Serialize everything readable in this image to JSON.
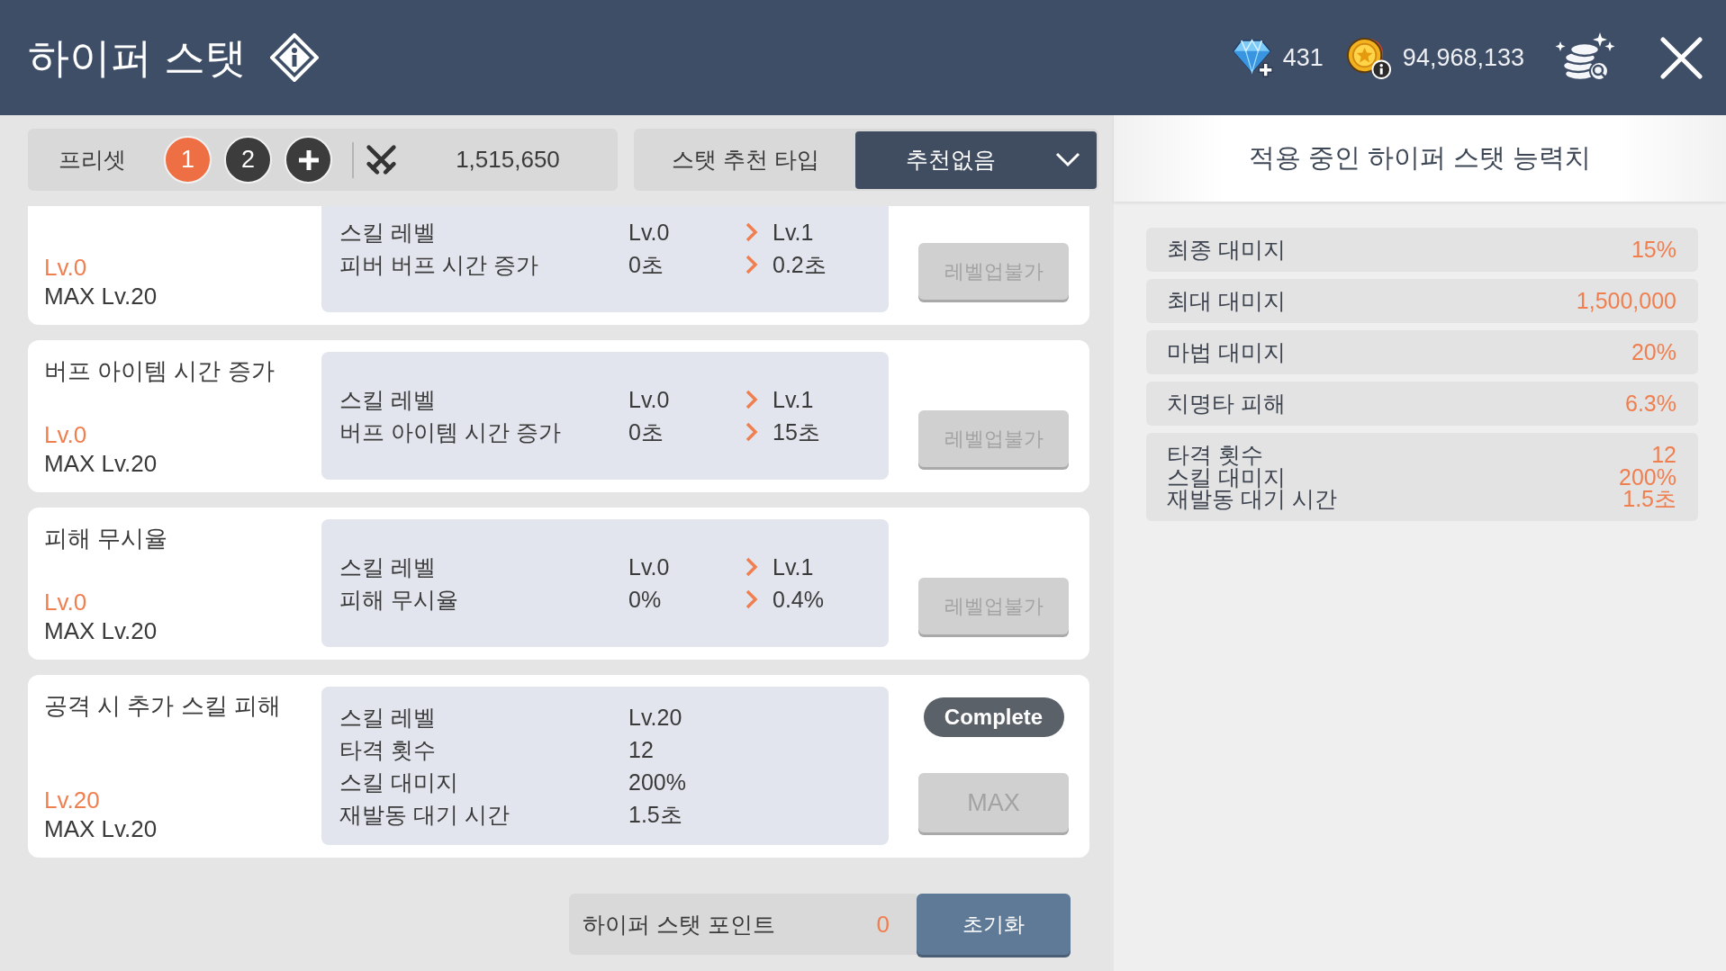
{
  "header": {
    "title": "하이퍼 스탯",
    "gems": "431",
    "gold": "94,968,133"
  },
  "toolbar": {
    "preset_label": "프리셋",
    "presets": [
      {
        "label": "1",
        "selected": true
      },
      {
        "label": "2",
        "selected": false
      }
    ],
    "combat_power": "1,515,650",
    "recommend_label": "스탯 추천 타입",
    "recommend_value": "추천없음"
  },
  "skills": [
    {
      "level": "Lv.0",
      "max_level": "MAX Lv.20",
      "stats": [
        {
          "label": "스킬 레벨",
          "current": "Lv.0",
          "next": "Lv.1"
        },
        {
          "label": "피버 버프 시간 증가",
          "current": "0초",
          "next": "0.2초"
        }
      ],
      "button": {
        "kind": "level_up",
        "label": "레벨업불가",
        "disabled": true
      }
    },
    {
      "title": "버프 아이템 시간 증가",
      "level": "Lv.0",
      "max_level": "MAX Lv.20",
      "stats": [
        {
          "label": "스킬 레벨",
          "current": "Lv.0",
          "next": "Lv.1"
        },
        {
          "label": "버프 아이템 시간 증가",
          "current": "0초",
          "next": "15초"
        }
      ],
      "button": {
        "kind": "level_up",
        "label": "레벨업불가",
        "disabled": true
      }
    },
    {
      "title": "피해 무시율",
      "level": "Lv.0",
      "max_level": "MAX Lv.20",
      "stats": [
        {
          "label": "스킬 레벨",
          "current": "Lv.0",
          "next": "Lv.1"
        },
        {
          "label": "피해 무시율",
          "current": "0%",
          "next": "0.4%"
        }
      ],
      "button": {
        "kind": "level_up",
        "label": "레벨업불가",
        "disabled": true
      }
    },
    {
      "title": "공격 시 추가 스킬 피해",
      "level": "Lv.20",
      "max_level": "MAX Lv.20",
      "stats": [
        {
          "label": "스킬 레벨",
          "current": "Lv.20"
        },
        {
          "label": "타격 횟수",
          "current": "12"
        },
        {
          "label": "스킬 대미지",
          "current": "200%"
        },
        {
          "label": "재발동 대기 시간",
          "current": "1.5초"
        }
      ],
      "status": "Complete",
      "button": {
        "kind": "max",
        "label": "MAX",
        "disabled": true
      }
    }
  ],
  "points": {
    "label": "하이퍼 스탯 포인트",
    "value": "0"
  },
  "reset_button": "초기화",
  "applied": {
    "title": "적용 중인 하이퍼 스탯 능력치",
    "rows": [
      {
        "labels": [
          "최종 대미지"
        ],
        "values": [
          "15%"
        ]
      },
      {
        "labels": [
          "최대 대미지"
        ],
        "values": [
          "1,500,000"
        ]
      },
      {
        "labels": [
          "마법 대미지"
        ],
        "values": [
          "20%"
        ]
      },
      {
        "labels": [
          "치명타 피해"
        ],
        "values": [
          "6.3%"
        ]
      },
      {
        "labels": [
          "타격 횟수",
          "스킬 대미지",
          "재발동 대기 시간"
        ],
        "values": [
          "12",
          "200%",
          "1.5초"
        ]
      }
    ]
  }
}
